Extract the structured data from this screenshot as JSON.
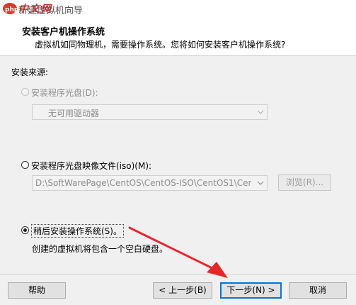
{
  "window": {
    "title": "新建虚拟机向导"
  },
  "header": {
    "title": "安装客户机操作系统",
    "subtitle": "虚拟机如同物理机，需要操作系统。您将如何安装客户机操作系统?"
  },
  "source_label": "安装来源:",
  "options": {
    "disc": {
      "label": "安装程序光盘(D):",
      "selected": false,
      "enabled": false,
      "drive_value": "无可用驱动器"
    },
    "iso": {
      "label": "安装程序光盘映像文件(iso)(M):",
      "selected": false,
      "enabled": true,
      "path_value": "D:\\SoftWarePage\\CentOS\\CentOS-ISO\\CentOS1\\CentO",
      "browse_label": "浏览(R)..."
    },
    "later": {
      "label": "稍后安装操作系统(S)。",
      "selected": true,
      "description": "创建的虚拟机将包含一个空白硬盘。"
    }
  },
  "buttons": {
    "help": "帮助",
    "back": "< 上一步(B)",
    "next": "下一步(N) >",
    "cancel": "取消"
  },
  "icons": {
    "app": "php-logo-icon",
    "chevron": "chevron-down-icon",
    "annotation": "red-arrow-icon"
  },
  "colors": {
    "focus_border": "#0078d7",
    "annotation_arrow": "#e8262a",
    "logo_text": "#c03030"
  }
}
